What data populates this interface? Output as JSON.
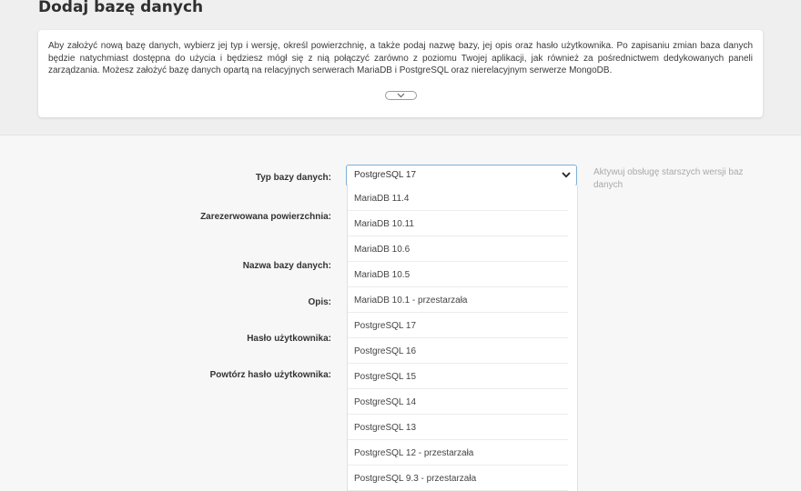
{
  "page": {
    "title": "Dodaj bazę danych"
  },
  "info": {
    "text": "Aby założyć nową bazę danych, wybierz jej typ i wersję, określ powierzchnię, a także podaj nazwę bazy, jej opis oraz hasło użytkownika. Po zapisaniu zmian baza danych będzie natychmiast dostępna do użycia i będziesz mógł się z nią połączyć zarówno z poziomu Twojej aplikacji, jak również za pośrednictwem dedykowanych paneli zarządzania. Możesz założyć bazę danych opartą na relacyjnych serwerach MariaDB i PostgreSQL oraz nierelacyjnym serwerze MongoDB.",
    "expand_icon": "chevron-down-icon"
  },
  "form": {
    "labels": {
      "db_type": "Typ bazy danych:",
      "reserved_space": "Zarezerwowana powierzchnia:",
      "db_name": "Nazwa bazy danych:",
      "description": "Opis:",
      "user_password": "Hasło użytkownika:",
      "repeat_password": "Powtórz hasło użytkownika:"
    },
    "db_type_select": {
      "selected": "PostgreSQL 17",
      "arrow_icon": "chevron-down-icon",
      "focus_color": "#7fb0d6",
      "options": [
        "MariaDB 11.4",
        "MariaDB 10.11",
        "MariaDB 10.6",
        "MariaDB 10.5",
        "MariaDB 10.1 - przestarzała",
        "PostgreSQL 17",
        "PostgreSQL 16",
        "PostgreSQL 15",
        "PostgreSQL 14",
        "PostgreSQL 13",
        "PostgreSQL 12 - przestarzała",
        "PostgreSQL 9.3 - przestarzała"
      ]
    },
    "legacy_hint": "Aktywuj obsługę starszych wersji baz danych"
  }
}
